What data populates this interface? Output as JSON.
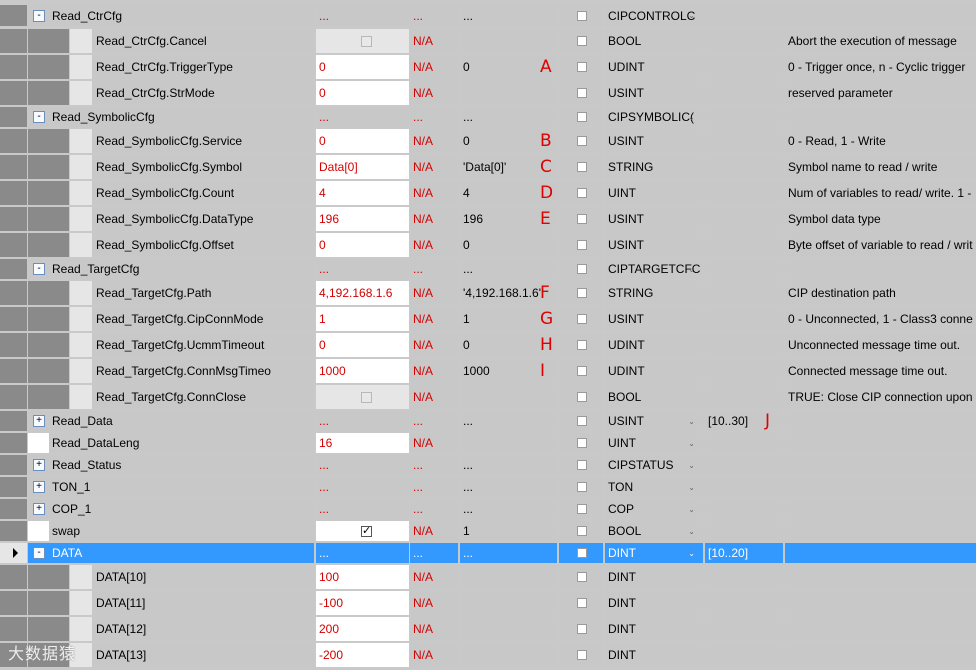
{
  "rows": [
    {
      "type": "group",
      "expanded": true,
      "name": "Read_CtrCfg",
      "value": "...",
      "force": "...",
      "start": "...",
      "const": false,
      "datatype": "CIPCONTROLC",
      "dd": true,
      "dim": "",
      "desc": "",
      "ann": ""
    },
    {
      "type": "member",
      "name": "Read_CtrCfg.Cancel",
      "value": "",
      "valcheck": "disabled",
      "force": "N/A",
      "start": "",
      "const": false,
      "datatype": "BOOL",
      "dd": false,
      "dim": "",
      "desc": "Abort the execution of message",
      "ann": ""
    },
    {
      "type": "member",
      "name": "Read_CtrCfg.TriggerType",
      "value": "0",
      "force": "N/A",
      "start": "0",
      "const": false,
      "datatype": "UDINT",
      "dd": false,
      "dim": "",
      "desc": "0 - Trigger once, n - Cyclic trigger",
      "ann": "A"
    },
    {
      "type": "member",
      "name": "Read_CtrCfg.StrMode",
      "value": "0",
      "force": "N/A",
      "start": "",
      "const": false,
      "datatype": "USINT",
      "dd": false,
      "dim": "",
      "desc": "reserved parameter",
      "ann": ""
    },
    {
      "type": "group",
      "expanded": true,
      "name": "Read_SymbolicCfg",
      "value": "...",
      "force": "...",
      "start": "...",
      "const": false,
      "datatype": "CIPSYMBOLIC(",
      "dd": true,
      "dim": "",
      "desc": "",
      "ann": ""
    },
    {
      "type": "member",
      "name": "Read_SymbolicCfg.Service",
      "value": "0",
      "force": "N/A",
      "start": "0",
      "const": false,
      "datatype": "USINT",
      "dd": false,
      "dim": "",
      "desc": "0 - Read, 1 - Write",
      "ann": "B"
    },
    {
      "type": "member",
      "name": "Read_SymbolicCfg.Symbol",
      "value": "Data[0]",
      "force": "N/A",
      "start": "'Data[0]'",
      "const": false,
      "datatype": "STRING",
      "dd": false,
      "dim": "",
      "desc": "Symbol name to read / write",
      "ann": "C"
    },
    {
      "type": "member",
      "name": "Read_SymbolicCfg.Count",
      "value": "4",
      "force": "N/A",
      "start": "4",
      "const": false,
      "datatype": "UINT",
      "dd": false,
      "dim": "",
      "desc": "Num of variables to read/ write. 1 -",
      "ann": "D"
    },
    {
      "type": "member",
      "name": "Read_SymbolicCfg.DataType",
      "value": "196",
      "force": "N/A",
      "start": "196",
      "const": false,
      "datatype": "USINT",
      "dd": false,
      "dim": "",
      "desc": "Symbol data type",
      "ann": "E"
    },
    {
      "type": "member",
      "name": "Read_SymbolicCfg.Offset",
      "value": "0",
      "force": "N/A",
      "start": "0",
      "const": false,
      "datatype": "USINT",
      "dd": false,
      "dim": "",
      "desc": "Byte offset of variable to read / writ",
      "ann": ""
    },
    {
      "type": "group",
      "expanded": true,
      "name": "Read_TargetCfg",
      "value": "...",
      "force": "...",
      "start": "...",
      "const": false,
      "datatype": "CIPTARGETCFC",
      "dd": true,
      "dim": "",
      "desc": "",
      "ann": ""
    },
    {
      "type": "member",
      "name": "Read_TargetCfg.Path",
      "value": "4,192.168.1.6",
      "force": "N/A",
      "start": "'4,192.168.1.6'",
      "const": false,
      "datatype": "STRING",
      "dd": false,
      "dim": "",
      "desc": "CIP destination path",
      "ann": "F"
    },
    {
      "type": "member",
      "name": "Read_TargetCfg.CipConnMode",
      "value": "1",
      "force": "N/A",
      "start": "1",
      "const": false,
      "datatype": "USINT",
      "dd": false,
      "dim": "",
      "desc": "0 - Unconnected, 1 - Class3 conne",
      "ann": "G"
    },
    {
      "type": "member",
      "name": "Read_TargetCfg.UcmmTimeout",
      "value": "0",
      "force": "N/A",
      "start": "0",
      "const": false,
      "datatype": "UDINT",
      "dd": false,
      "dim": "",
      "desc": "Unconnected message time out.",
      "ann": "H"
    },
    {
      "type": "member",
      "name": "Read_TargetCfg.ConnMsgTimeo",
      "value": "1000",
      "force": "N/A",
      "start": "1000",
      "const": false,
      "datatype": "UDINT",
      "dd": false,
      "dim": "",
      "desc": "Connected message time out.",
      "ann": "I"
    },
    {
      "type": "member",
      "name": "Read_TargetCfg.ConnClose",
      "value": "",
      "valcheck": "disabled",
      "force": "N/A",
      "start": "",
      "const": false,
      "datatype": "BOOL",
      "dd": false,
      "dim": "",
      "desc": "TRUE: Close CIP connection upon n",
      "ann": ""
    },
    {
      "type": "group",
      "expanded": false,
      "name": "Read_Data",
      "value": "...",
      "force": "...",
      "start": "...",
      "const": false,
      "datatype": "USINT",
      "dd": true,
      "dim": "[10..30]",
      "desc": "",
      "ann": "J"
    },
    {
      "type": "top",
      "name": "Read_DataLeng",
      "value": "16",
      "force": "N/A",
      "start": "",
      "const": false,
      "datatype": "UINT",
      "dd": true,
      "dim": "",
      "desc": "",
      "ann": ""
    },
    {
      "type": "group",
      "expanded": false,
      "name": "Read_Status",
      "value": "...",
      "force": "...",
      "start": "...",
      "const": false,
      "datatype": "CIPSTATUS",
      "dd": true,
      "dim": "",
      "desc": "",
      "ann": ""
    },
    {
      "type": "group",
      "expanded": false,
      "name": "TON_1",
      "value": "...",
      "force": "...",
      "start": "...",
      "const": false,
      "datatype": "TON",
      "dd": true,
      "dim": "",
      "desc": "",
      "ann": ""
    },
    {
      "type": "group",
      "expanded": false,
      "name": "COP_1",
      "value": "...",
      "force": "...",
      "start": "...",
      "const": false,
      "datatype": "COP",
      "dd": true,
      "dim": "",
      "desc": "",
      "ann": ""
    },
    {
      "type": "top",
      "name": "swap",
      "value": "",
      "valcheck": "checked",
      "force": "N/A",
      "start": "1",
      "const": false,
      "datatype": "BOOL",
      "dd": true,
      "dim": "",
      "desc": "",
      "ann": ""
    },
    {
      "type": "group",
      "expanded": true,
      "selected": true,
      "name": "DATA",
      "value": "...",
      "force": "...",
      "start": "...",
      "const": false,
      "datatype": "DINT",
      "dd": true,
      "dim": "[10..20]",
      "desc": "",
      "ann": ""
    },
    {
      "type": "member",
      "name": "DATA[10]",
      "value": "100",
      "force": "N/A",
      "start": "",
      "const": false,
      "datatype": "DINT",
      "dd": false,
      "dim": "",
      "desc": "",
      "ann": ""
    },
    {
      "type": "member",
      "name": "DATA[11]",
      "value": "-100",
      "force": "N/A",
      "start": "",
      "const": false,
      "datatype": "DINT",
      "dd": false,
      "dim": "",
      "desc": "",
      "ann": ""
    },
    {
      "type": "member",
      "name": "DATA[12]",
      "value": "200",
      "force": "N/A",
      "start": "",
      "const": false,
      "datatype": "DINT",
      "dd": false,
      "dim": "",
      "desc": "",
      "ann": ""
    },
    {
      "type": "member",
      "name": "DATA[13]",
      "value": "-200",
      "force": "N/A",
      "start": "",
      "const": false,
      "datatype": "DINT",
      "dd": false,
      "dim": "",
      "desc": "",
      "ann": ""
    }
  ],
  "watermark": "大数据猿",
  "expand_symbols": {
    "expanded": "-",
    "collapsed": "+"
  },
  "colors": {
    "value_text": "#d40000",
    "annotation": "#e00000",
    "selection": "#3399ff"
  }
}
